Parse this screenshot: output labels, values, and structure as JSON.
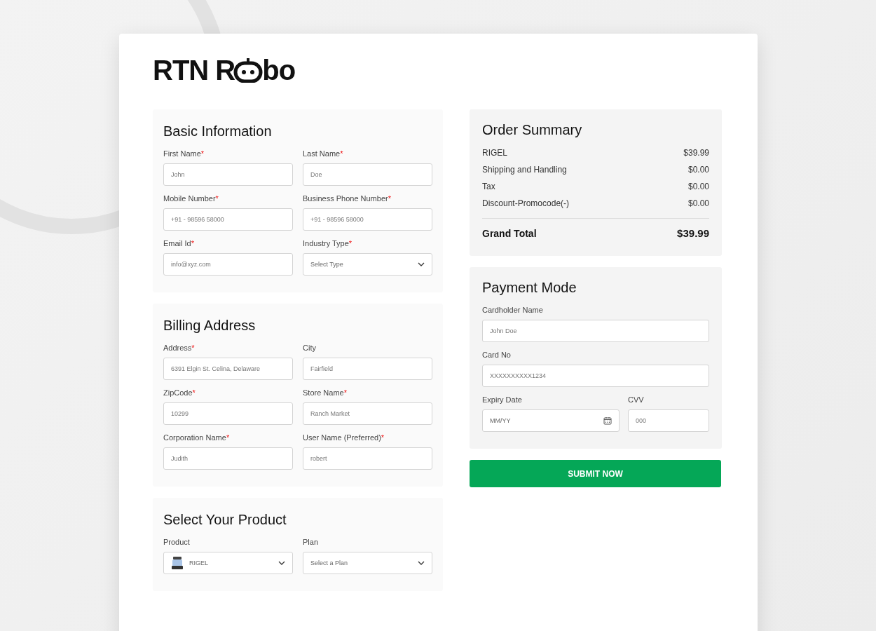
{
  "logo": {
    "before": "RTN R",
    "after": "bo"
  },
  "sections": [
    {
      "title": "Basic Information",
      "fields": [
        {
          "kind": "text",
          "label": "First Name",
          "mark": "*",
          "placeholder": "John"
        },
        {
          "kind": "text",
          "label": "Last Name",
          "mark": "*",
          "placeholder": "Doe"
        },
        {
          "kind": "text",
          "label": "Mobile Number",
          "mark": "*",
          "placeholder": "+91 - 98596 58000"
        },
        {
          "kind": "text",
          "label": "Business Phone Number",
          "mark": "*",
          "placeholder": "+91 - 98596 58000"
        },
        {
          "kind": "text",
          "label": "Email Id",
          "mark": "*",
          "placeholder": "info@xyz.com"
        },
        {
          "kind": "select",
          "label": "Industry Type",
          "mark": "*",
          "placeholder": "Select Type"
        }
      ]
    },
    {
      "title": "Billing Address",
      "fields": [
        {
          "kind": "text",
          "label": "Address",
          "mark": "*",
          "placeholder": "6391 Elgin St. Celina, Delaware"
        },
        {
          "kind": "text",
          "label": "City",
          "placeholder": "Fairfield"
        },
        {
          "kind": "text",
          "label": "ZipCode",
          "mark": "*",
          "placeholder": "10299"
        },
        {
          "kind": "text",
          "label": "Store Name",
          "mark": "*",
          "placeholder": "Ranch Market"
        },
        {
          "kind": "text",
          "label": "Corporation Name",
          "mark": "*",
          "placeholder": "Judith"
        },
        {
          "kind": "text",
          "label": "User Name (Preferred)",
          "mark": "*",
          "placeholder": "robert"
        }
      ]
    },
    {
      "title": "Select Your Product",
      "fields": [
        {
          "kind": "product",
          "label": "Product",
          "value": "RIGEL"
        },
        {
          "kind": "select",
          "label": "Plan",
          "placeholder": "Select a Plan"
        }
      ]
    }
  ],
  "order_summary": {
    "title": "Order Summary",
    "items": [
      {
        "label": "RIGEL",
        "amount": "$39.99"
      },
      {
        "label": "Shipping and Handling",
        "amount": "$0.00"
      },
      {
        "label": "Tax",
        "amount": "$0.00"
      },
      {
        "label": "Discount-Promocode(-)",
        "amount": "$0.00"
      }
    ],
    "total": {
      "label": "Grand Total",
      "amount": "$39.99"
    }
  },
  "payment": {
    "title": "Payment Mode",
    "fields": [
      {
        "kind": "text",
        "label": "Cardholder Name",
        "placeholder": "John Doe"
      },
      {
        "kind": "text",
        "label": "Card No",
        "placeholder": "XXXXXXXXXX1234"
      },
      {
        "kind": "date",
        "label": "Expiry Date",
        "placeholder": "MM/YY"
      },
      {
        "kind": "text",
        "label": "CVV",
        "placeholder": "000"
      }
    ]
  },
  "submit": "SUBMIT NOW"
}
